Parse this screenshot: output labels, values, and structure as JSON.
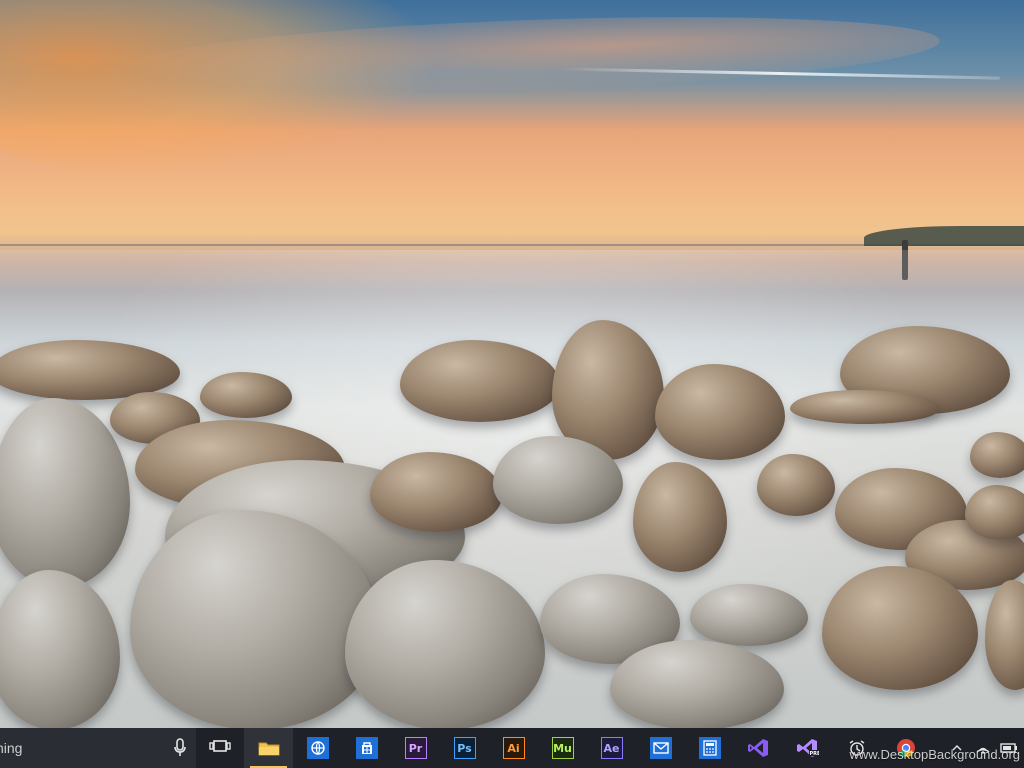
{
  "desktop": {
    "wallpaper": "sunset-coastal-rocks"
  },
  "taskbar": {
    "search_text": "hing",
    "icons": {
      "mic": "microphone-icon",
      "task_view": "task-view-icon"
    },
    "apps": [
      {
        "id": "file-explorer",
        "label": "",
        "bg": "#e6b24b",
        "fg": "#fff"
      },
      {
        "id": "ie",
        "label": "",
        "bg": "#1e6fd6",
        "fg": "#fff"
      },
      {
        "id": "store",
        "label": "",
        "bg": "#1e6fd6",
        "fg": "#fff"
      },
      {
        "id": "premiere",
        "label": "Pr",
        "bg": "#2a1b3b",
        "fg": "#d6a8ff",
        "border": "#b682ff"
      },
      {
        "id": "photoshop",
        "label": "Ps",
        "bg": "#0b2034",
        "fg": "#6fc1ff",
        "border": "#3fa0ff"
      },
      {
        "id": "illustrator",
        "label": "Ai",
        "bg": "#2a1a0b",
        "fg": "#ff9b3a",
        "border": "#ff8a24"
      },
      {
        "id": "muse",
        "label": "Mu",
        "bg": "#1a2b12",
        "fg": "#b7f05a",
        "border": "#9fd23f"
      },
      {
        "id": "aftereffects",
        "label": "Ae",
        "bg": "#1c1b3b",
        "fg": "#b1a4ff",
        "border": "#8c7bff"
      },
      {
        "id": "mail",
        "label": "",
        "bg": "#1e6fd6",
        "fg": "#fff"
      },
      {
        "id": "calculator",
        "label": "",
        "bg": "#1e6fd6",
        "fg": "#fff"
      },
      {
        "id": "vs",
        "label": "",
        "bg": "transparent",
        "fg": "#b58cff"
      },
      {
        "id": "vs-pre",
        "label": "",
        "bg": "transparent",
        "fg": "#b58cff"
      },
      {
        "id": "alarm",
        "label": "",
        "bg": "transparent",
        "fg": "#fff"
      },
      {
        "id": "chrome",
        "label": "",
        "bg": "transparent",
        "fg": "#fff"
      }
    ],
    "tray": {
      "chevron_up": "chevron-up-icon",
      "network": "network-icon",
      "battery": "battery-icon"
    }
  },
  "watermark": {
    "text": "www.DesktopBackground.org"
  }
}
